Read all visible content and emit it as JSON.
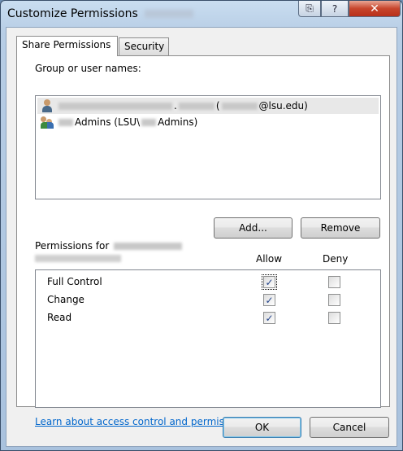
{
  "window": {
    "title": "Customize Permissions"
  },
  "titlebar_buttons": {
    "help": "?",
    "close": "✕"
  },
  "tabs": [
    {
      "label": "Share Permissions",
      "active": true
    },
    {
      "label": "Security",
      "active": false
    }
  ],
  "groups": {
    "label": "Group or user names:",
    "items": [
      {
        "icon": "user-icon",
        "text_prefix": ".",
        "text_mid": "(",
        "text_suffix": "@lsu.edu)",
        "selected": true
      },
      {
        "icon": "group-icon",
        "text_prefix": "Admins (LSU\\",
        "text_suffix": "Admins)",
        "selected": false
      }
    ]
  },
  "buttons": {
    "add": "Add...",
    "remove": "Remove",
    "ok": "OK",
    "cancel": "Cancel"
  },
  "permissions": {
    "label": "Permissions for",
    "col_allow": "Allow",
    "col_deny": "Deny",
    "rows": [
      {
        "name": "Full Control",
        "allow": true,
        "deny": false
      },
      {
        "name": "Change",
        "allow": true,
        "deny": false
      },
      {
        "name": "Read",
        "allow": true,
        "deny": false
      }
    ]
  },
  "link": {
    "text": "Learn about access control and permissions"
  },
  "colors": {
    "link": "#0066cc",
    "close_button": "#c7452c",
    "checkmark": "#24448a"
  }
}
